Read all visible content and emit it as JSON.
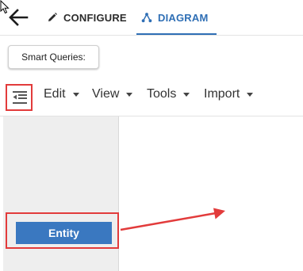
{
  "header": {
    "tabs": [
      {
        "label": "CONFIGURE",
        "icon": "pencil-icon",
        "active": false
      },
      {
        "label": "DIAGRAM",
        "icon": "diagram-icon",
        "active": true
      }
    ]
  },
  "smart_queries": {
    "label": "Smart Queries:"
  },
  "toolbar": {
    "menus": [
      {
        "label": "Edit"
      },
      {
        "label": "View"
      },
      {
        "label": "Tools"
      },
      {
        "label": "Import"
      }
    ]
  },
  "palette": {
    "entity_label": "Entity"
  },
  "colors": {
    "accent": "#2f6fb5",
    "entity": "#3a78c0",
    "highlight": "#e23b3b"
  }
}
